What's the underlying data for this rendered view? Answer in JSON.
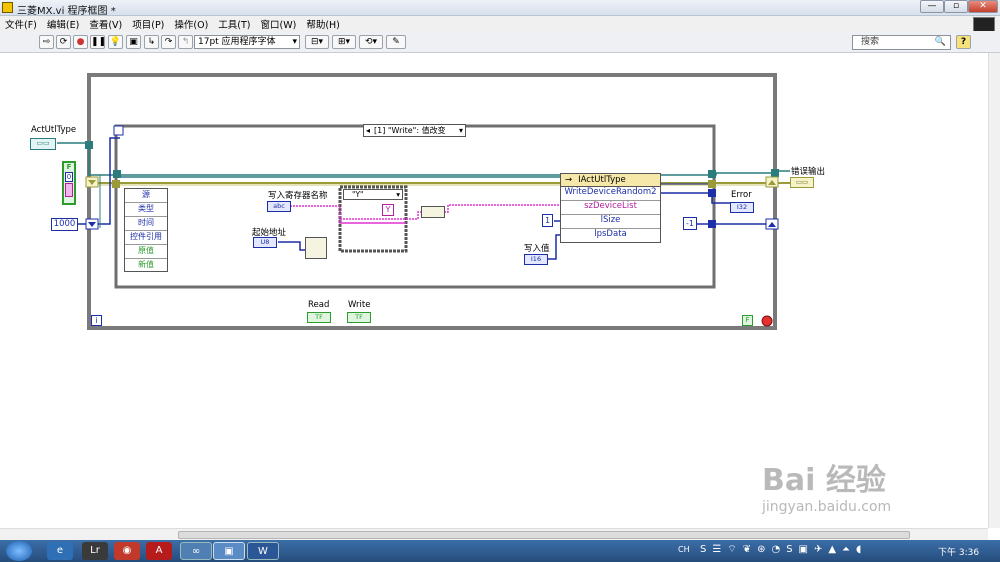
{
  "window": {
    "title": "三菱MX.vi 程序框图 *",
    "minimize": "—",
    "maximize": "▫",
    "close": "✕"
  },
  "menu": [
    "文件(F)",
    "编辑(E)",
    "查看(V)",
    "项目(P)",
    "操作(O)",
    "工具(T)",
    "窗口(W)",
    "帮助(H)"
  ],
  "toolbar": {
    "font": "17pt 应用程序字体",
    "search_placeholder": "搜索",
    "help": "?"
  },
  "diagram": {
    "actutl_label": "ActUtlType",
    "bool_ctrl": "F",
    "bool_num": "0",
    "wait_value": "1000",
    "case_selector": "[1] \"Write\": 值改变",
    "event_items": [
      "源",
      "类型",
      "时间",
      "控件引用",
      "原值",
      "新值"
    ],
    "reg_label": "写入寄存器名称",
    "case_y": "\"Y\"",
    "y_const": "Y",
    "start_label": "起始地址",
    "start_type": "U8",
    "write_val_label": "写入值",
    "write_val_type": "I16",
    "reg_ctrl_type": "abc",
    "num_const": "1",
    "node_class": "IActUtlType",
    "node_method": "WriteDeviceRandom2",
    "node_param1": "szDeviceList",
    "node_param2": "lSize",
    "node_param3": "lpsData",
    "error_label": "Error",
    "error_type": "I32",
    "neg_const": "-1",
    "error_out_label": "错误输出",
    "read_label": "Read",
    "write_label": "Write",
    "tf": "TF",
    "iter": "i",
    "stop_const": "F",
    "loop_index": "i"
  },
  "taskbar": {
    "lang": "CH",
    "time": "下午 3:36"
  },
  "watermark": {
    "main": "Bai 经验",
    "url": "jingyan.baidu.com"
  }
}
